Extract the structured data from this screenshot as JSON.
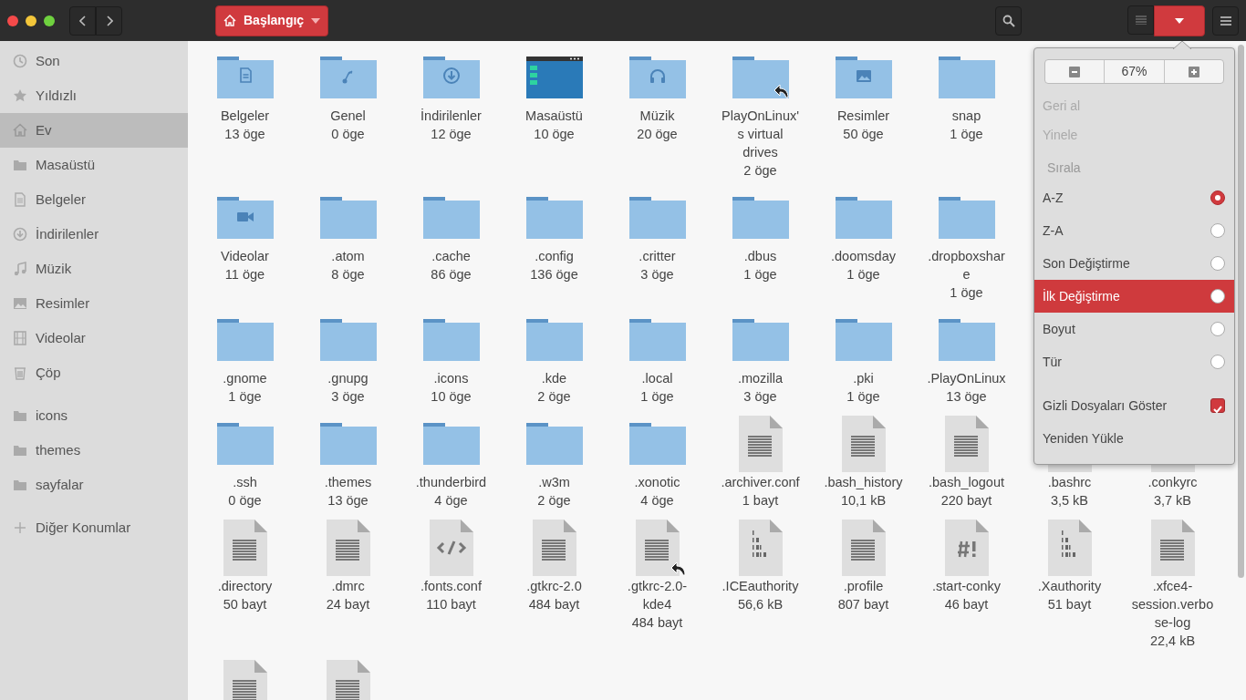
{
  "header": {
    "location": "Başlangıç"
  },
  "sidebar": {
    "groups": [
      {
        "items": [
          {
            "label": "Son",
            "kind": "recent",
            "selected": false
          },
          {
            "label": "Yıldızlı",
            "kind": "star",
            "selected": false
          },
          {
            "label": "Ev",
            "kind": "home",
            "selected": true
          },
          {
            "label": "Masaüstü",
            "kind": "folder",
            "selected": false
          },
          {
            "label": "Belgeler",
            "kind": "document",
            "selected": false
          },
          {
            "label": "İndirilenler",
            "kind": "download",
            "selected": false
          },
          {
            "label": "Müzik",
            "kind": "music",
            "selected": false
          },
          {
            "label": "Resimler",
            "kind": "picture",
            "selected": false
          },
          {
            "label": "Videolar",
            "kind": "video",
            "selected": false
          },
          {
            "label": "Çöp",
            "kind": "trash",
            "selected": false
          }
        ]
      },
      {
        "items": [
          {
            "label": "icons",
            "kind": "folder",
            "selected": false
          },
          {
            "label": "themes",
            "kind": "folder",
            "selected": false
          },
          {
            "label": "sayfalar",
            "kind": "folder",
            "selected": false
          }
        ]
      },
      {
        "items": [
          {
            "label": "Diğer Konumlar",
            "kind": "add",
            "selected": false
          }
        ]
      }
    ]
  },
  "files": {
    "rows": [
      [
        {
          "name": "Belgeler",
          "info": "13 öge",
          "kind": "folder-document",
          "link": false
        },
        {
          "name": "Genel",
          "info": "0 öge",
          "kind": "folder-share",
          "link": false
        },
        {
          "name": "İndirilenler",
          "info": "12 öge",
          "kind": "folder-download",
          "link": false
        },
        {
          "name": "Masaüstü",
          "info": "10 öge",
          "kind": "desktop",
          "link": false
        },
        {
          "name": "Müzik",
          "info": "20 öge",
          "kind": "folder-music",
          "link": false
        },
        {
          "name": "PlayOnLinux's virtual drives",
          "info": "2 öge",
          "kind": "folder",
          "link": true
        },
        {
          "name": "Resimler",
          "info": "50 öge",
          "kind": "folder-picture",
          "link": false
        },
        {
          "name": "snap",
          "info": "1 öge",
          "kind": "folder",
          "link": false
        }
      ],
      [
        {
          "name": "Videolar",
          "info": "11 öge",
          "kind": "folder-video",
          "link": false
        },
        {
          "name": ".atom",
          "info": "8 öge",
          "kind": "folder",
          "link": false
        },
        {
          "name": ".cache",
          "info": "86 öge",
          "kind": "folder",
          "link": false
        },
        {
          "name": ".config",
          "info": "136 öge",
          "kind": "folder",
          "link": false
        },
        {
          "name": ".critter",
          "info": "3 öge",
          "kind": "folder",
          "link": false
        },
        {
          "name": ".dbus",
          "info": "1 öge",
          "kind": "folder",
          "link": false
        },
        {
          "name": ".doomsday",
          "info": "1 öge",
          "kind": "folder",
          "link": false
        },
        {
          "name": ".dropboxshare",
          "info": "1 öge",
          "kind": "folder",
          "link": false
        }
      ],
      [
        {
          "name": ".gnome",
          "info": "1 öge",
          "kind": "folder",
          "link": false
        },
        {
          "name": ".gnupg",
          "info": "3 öge",
          "kind": "folder",
          "link": false
        },
        {
          "name": ".icons",
          "info": "10 öge",
          "kind": "folder",
          "link": false
        },
        {
          "name": ".kde",
          "info": "2 öge",
          "kind": "folder",
          "link": false
        },
        {
          "name": ".local",
          "info": "1 öge",
          "kind": "folder",
          "link": false
        },
        {
          "name": ".mozilla",
          "info": "3 öge",
          "kind": "folder",
          "link": false
        },
        {
          "name": ".pki",
          "info": "1 öge",
          "kind": "folder",
          "link": false
        },
        {
          "name": ".PlayOnLinux",
          "info": "13 öge",
          "kind": "folder",
          "link": false
        }
      ],
      [
        {
          "name": ".ssh",
          "info": "0 öge",
          "kind": "folder",
          "link": false
        },
        {
          "name": ".themes",
          "info": "13 öge",
          "kind": "folder",
          "link": false
        },
        {
          "name": ".thunderbird",
          "info": "4 öge",
          "kind": "folder",
          "link": false
        },
        {
          "name": ".w3m",
          "info": "2 öge",
          "kind": "folder",
          "link": false
        },
        {
          "name": ".xonotic",
          "info": "4 öge",
          "kind": "folder",
          "link": false
        },
        {
          "name": ".archiver.conf",
          "info": "1 bayt",
          "kind": "text",
          "link": false
        },
        {
          "name": ".bash_history",
          "info": "10,1 kB",
          "kind": "text",
          "link": false
        },
        {
          "name": ".bash_logout",
          "info": "220 bayt",
          "kind": "text",
          "link": false
        },
        {
          "name": ".bashrc",
          "info": "3,5 kB",
          "kind": "text",
          "link": false
        },
        {
          "name": ".conkyrc",
          "info": "3,7 kB",
          "kind": "text",
          "link": false
        }
      ],
      [
        {
          "name": ".directory",
          "info": "50 bayt",
          "kind": "text",
          "link": false
        },
        {
          "name": ".dmrc",
          "info": "24 bayt",
          "kind": "text",
          "link": false
        },
        {
          "name": ".fonts.conf",
          "info": "110 bayt",
          "kind": "code",
          "link": false
        },
        {
          "name": ".gtkrc-2.0",
          "info": "484 bayt",
          "kind": "text",
          "link": false
        },
        {
          "name": ".gtkrc-2.0-kde4",
          "info": "484 bayt",
          "kind": "text",
          "link": true
        },
        {
          "name": ".ICEauthority",
          "info": "56,6 kB",
          "kind": "binary",
          "link": false
        },
        {
          "name": ".profile",
          "info": "807 bayt",
          "kind": "text",
          "link": false
        },
        {
          "name": ".start-conky",
          "info": "46 bayt",
          "kind": "script",
          "link": false
        },
        {
          "name": ".Xauthority",
          "info": "51 bayt",
          "kind": "binary",
          "link": false
        },
        {
          "name": ".xfce4-session.verbose-log",
          "info": "22,4 kB",
          "kind": "text",
          "link": false
        }
      ],
      [
        {
          "kind": "text"
        },
        {
          "kind": "text"
        }
      ]
    ]
  },
  "menu": {
    "zoom": "67%",
    "history": [
      {
        "label": "Geri al",
        "disabled": true
      },
      {
        "label": "Yinele",
        "disabled": true
      }
    ],
    "sort_heading": "Sırala",
    "sort": [
      {
        "label": "A-Z",
        "selected": true,
        "highlighted": false
      },
      {
        "label": "Z-A",
        "selected": false,
        "highlighted": false
      },
      {
        "label": "Son Değiştirme",
        "selected": false,
        "highlighted": false
      },
      {
        "label": "İlk Değiştirme",
        "selected": false,
        "highlighted": true
      },
      {
        "label": "Boyut",
        "selected": false,
        "highlighted": false
      },
      {
        "label": "Tür",
        "selected": false,
        "highlighted": false
      }
    ],
    "hidden_files": {
      "label": "Gizli Dosyaları Göster",
      "checked": true
    },
    "reload": "Yeniden Yükle"
  }
}
